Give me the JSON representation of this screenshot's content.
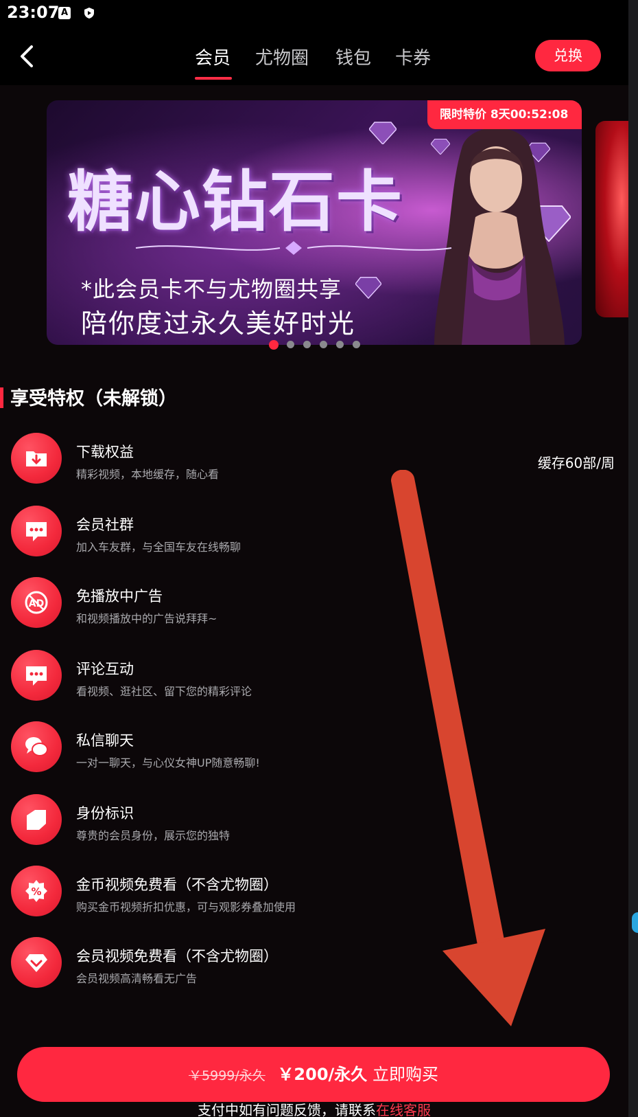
{
  "status_bar": {
    "time": "23:07",
    "icons": [
      "a-notification-icon",
      "shield-icon"
    ]
  },
  "nav": {
    "tabs": [
      {
        "label": "会员",
        "active": true
      },
      {
        "label": "尤物圈",
        "active": false
      },
      {
        "label": "钱包",
        "active": false
      },
      {
        "label": "卡券",
        "active": false
      }
    ],
    "redeem_label": "兑换"
  },
  "banner": {
    "title": "糖心钻石卡",
    "line1": "*此会员卡不与尤物圈共享",
    "line2": "陪你度过永久美好时光",
    "promo_label": "限时特价",
    "promo_countdown": "8天00:52:08",
    "dot_count": 6,
    "active_dot": 0
  },
  "section": {
    "title": "享受特权（未解锁）"
  },
  "privileges": [
    {
      "icon": "download-folder-icon",
      "title": "下载权益",
      "subtitle": "精彩视频，本地缓存，随心看",
      "right": "缓存60部/周"
    },
    {
      "icon": "group-chat-icon",
      "title": "会员社群",
      "subtitle": "加入车友群，与全国车友在线畅聊",
      "right": ""
    },
    {
      "icon": "ad-free-icon",
      "title": "免播放中广告",
      "subtitle": "和视频播放中的广告说拜拜~",
      "right": ""
    },
    {
      "icon": "comment-icon",
      "title": "评论互动",
      "subtitle": "看视频、逛社区、留下您的精彩评论",
      "right": ""
    },
    {
      "icon": "private-message-icon",
      "title": "私信聊天",
      "subtitle": "一对一聊天，与心仪女神UP随意畅聊!",
      "right": ""
    },
    {
      "icon": "identity-badge-icon",
      "title": "身份标识",
      "subtitle": "尊贵的会员身份，展示您的独特",
      "right": ""
    },
    {
      "icon": "discount-icon",
      "title": "金币视频免费看（不含尤物圈）",
      "subtitle": "购买金币视频折扣优惠，可与观影券叠加使用",
      "right": ""
    },
    {
      "icon": "diamond-icon",
      "title": "会员视频免费看（不含尤物圈）",
      "subtitle": "会员视频高清畅看无广告",
      "right": ""
    }
  ],
  "help": {
    "text": "支付中如有问题反馈，请联系",
    "link": "在线客服"
  },
  "purchase": {
    "original_price": "￥5999/永久",
    "price": "￥200/永久",
    "action": "立即购买"
  },
  "colors": {
    "accent": "#ff2840",
    "background": "#0c0709",
    "arrow": "#d8452f"
  }
}
